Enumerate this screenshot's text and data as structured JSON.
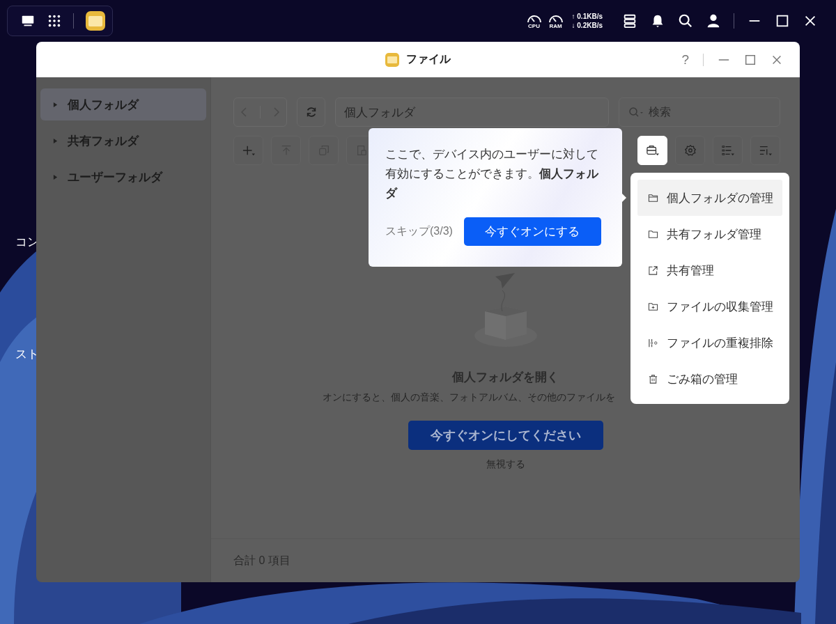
{
  "taskbar": {
    "cpu_label": "CPU",
    "ram_label": "RAM",
    "upload": "↑ 0.1KB/s",
    "download": "↓ 0.2KB/s"
  },
  "desktop_icons": [
    {
      "label": "コン"
    },
    {
      "label": "スト"
    }
  ],
  "window": {
    "title": "ファイル",
    "help": "?"
  },
  "sidebar": {
    "items": [
      {
        "label": "個人フォルダ",
        "selected": true
      },
      {
        "label": "共有フォルダ",
        "selected": false
      },
      {
        "label": "ユーザーフォルダ",
        "selected": false
      }
    ]
  },
  "toolbar": {
    "path": "個人フォルダ",
    "search_placeholder": "検索"
  },
  "empty_state": {
    "title": "個人フォルダを開く",
    "description": "オンにすると、個人の音楽、フォトアルバム、その他のファイルを",
    "button": "今すぐオンにしてください",
    "ignore": "無視する"
  },
  "status_bar": {
    "total": "合計 0 項目"
  },
  "tour_tip": {
    "text": "ここで、デバイス内のユーザーに対して有効にすることができます。**個人フォルダ**",
    "skip": "スキップ(3/3)",
    "button": "今すぐオンにする"
  },
  "menu": {
    "items": [
      {
        "label": "個人フォルダの管理",
        "kind": "folder",
        "selected": true
      },
      {
        "label": "共有フォルダ管理",
        "kind": "shared-folder",
        "selected": false
      },
      {
        "label": "共有管理",
        "kind": "share",
        "selected": false
      },
      {
        "label": "ファイルの収集管理",
        "kind": "collect",
        "selected": false
      },
      {
        "label": "ファイルの重複排除",
        "kind": "dedupe",
        "selected": false
      },
      {
        "label": "ごみ箱の管理",
        "kind": "trash",
        "selected": false
      }
    ]
  }
}
